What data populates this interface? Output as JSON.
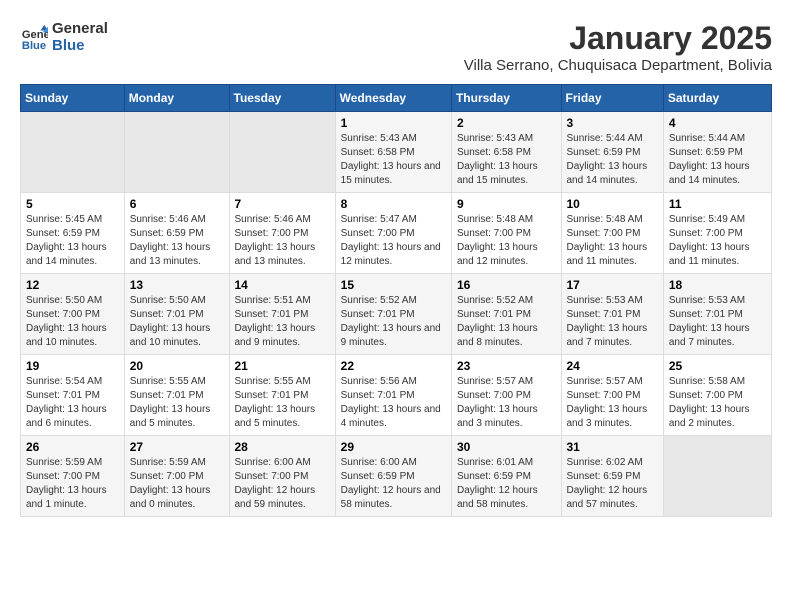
{
  "logo": {
    "text_general": "General",
    "text_blue": "Blue"
  },
  "title": "January 2025",
  "subtitle": "Villa Serrano, Chuquisaca Department, Bolivia",
  "days_of_week": [
    "Sunday",
    "Monday",
    "Tuesday",
    "Wednesday",
    "Thursday",
    "Friday",
    "Saturday"
  ],
  "weeks": [
    [
      {
        "day": "",
        "empty": true
      },
      {
        "day": "",
        "empty": true
      },
      {
        "day": "",
        "empty": true
      },
      {
        "day": "1",
        "sunrise": "5:43 AM",
        "sunset": "6:58 PM",
        "daylight": "13 hours and 15 minutes."
      },
      {
        "day": "2",
        "sunrise": "5:43 AM",
        "sunset": "6:58 PM",
        "daylight": "13 hours and 15 minutes."
      },
      {
        "day": "3",
        "sunrise": "5:44 AM",
        "sunset": "6:59 PM",
        "daylight": "13 hours and 14 minutes."
      },
      {
        "day": "4",
        "sunrise": "5:44 AM",
        "sunset": "6:59 PM",
        "daylight": "13 hours and 14 minutes."
      }
    ],
    [
      {
        "day": "5",
        "sunrise": "5:45 AM",
        "sunset": "6:59 PM",
        "daylight": "13 hours and 14 minutes."
      },
      {
        "day": "6",
        "sunrise": "5:46 AM",
        "sunset": "6:59 PM",
        "daylight": "13 hours and 13 minutes."
      },
      {
        "day": "7",
        "sunrise": "5:46 AM",
        "sunset": "7:00 PM",
        "daylight": "13 hours and 13 minutes."
      },
      {
        "day": "8",
        "sunrise": "5:47 AM",
        "sunset": "7:00 PM",
        "daylight": "13 hours and 12 minutes."
      },
      {
        "day": "9",
        "sunrise": "5:48 AM",
        "sunset": "7:00 PM",
        "daylight": "13 hours and 12 minutes."
      },
      {
        "day": "10",
        "sunrise": "5:48 AM",
        "sunset": "7:00 PM",
        "daylight": "13 hours and 11 minutes."
      },
      {
        "day": "11",
        "sunrise": "5:49 AM",
        "sunset": "7:00 PM",
        "daylight": "13 hours and 11 minutes."
      }
    ],
    [
      {
        "day": "12",
        "sunrise": "5:50 AM",
        "sunset": "7:00 PM",
        "daylight": "13 hours and 10 minutes."
      },
      {
        "day": "13",
        "sunrise": "5:50 AM",
        "sunset": "7:01 PM",
        "daylight": "13 hours and 10 minutes."
      },
      {
        "day": "14",
        "sunrise": "5:51 AM",
        "sunset": "7:01 PM",
        "daylight": "13 hours and 9 minutes."
      },
      {
        "day": "15",
        "sunrise": "5:52 AM",
        "sunset": "7:01 PM",
        "daylight": "13 hours and 9 minutes."
      },
      {
        "day": "16",
        "sunrise": "5:52 AM",
        "sunset": "7:01 PM",
        "daylight": "13 hours and 8 minutes."
      },
      {
        "day": "17",
        "sunrise": "5:53 AM",
        "sunset": "7:01 PM",
        "daylight": "13 hours and 7 minutes."
      },
      {
        "day": "18",
        "sunrise": "5:53 AM",
        "sunset": "7:01 PM",
        "daylight": "13 hours and 7 minutes."
      }
    ],
    [
      {
        "day": "19",
        "sunrise": "5:54 AM",
        "sunset": "7:01 PM",
        "daylight": "13 hours and 6 minutes."
      },
      {
        "day": "20",
        "sunrise": "5:55 AM",
        "sunset": "7:01 PM",
        "daylight": "13 hours and 5 minutes."
      },
      {
        "day": "21",
        "sunrise": "5:55 AM",
        "sunset": "7:01 PM",
        "daylight": "13 hours and 5 minutes."
      },
      {
        "day": "22",
        "sunrise": "5:56 AM",
        "sunset": "7:01 PM",
        "daylight": "13 hours and 4 minutes."
      },
      {
        "day": "23",
        "sunrise": "5:57 AM",
        "sunset": "7:00 PM",
        "daylight": "13 hours and 3 minutes."
      },
      {
        "day": "24",
        "sunrise": "5:57 AM",
        "sunset": "7:00 PM",
        "daylight": "13 hours and 3 minutes."
      },
      {
        "day": "25",
        "sunrise": "5:58 AM",
        "sunset": "7:00 PM",
        "daylight": "13 hours and 2 minutes."
      }
    ],
    [
      {
        "day": "26",
        "sunrise": "5:59 AM",
        "sunset": "7:00 PM",
        "daylight": "13 hours and 1 minute."
      },
      {
        "day": "27",
        "sunrise": "5:59 AM",
        "sunset": "7:00 PM",
        "daylight": "13 hours and 0 minutes."
      },
      {
        "day": "28",
        "sunrise": "6:00 AM",
        "sunset": "7:00 PM",
        "daylight": "12 hours and 59 minutes."
      },
      {
        "day": "29",
        "sunrise": "6:00 AM",
        "sunset": "6:59 PM",
        "daylight": "12 hours and 58 minutes."
      },
      {
        "day": "30",
        "sunrise": "6:01 AM",
        "sunset": "6:59 PM",
        "daylight": "12 hours and 58 minutes."
      },
      {
        "day": "31",
        "sunrise": "6:02 AM",
        "sunset": "6:59 PM",
        "daylight": "12 hours and 57 minutes."
      },
      {
        "day": "",
        "empty": true
      }
    ]
  ]
}
